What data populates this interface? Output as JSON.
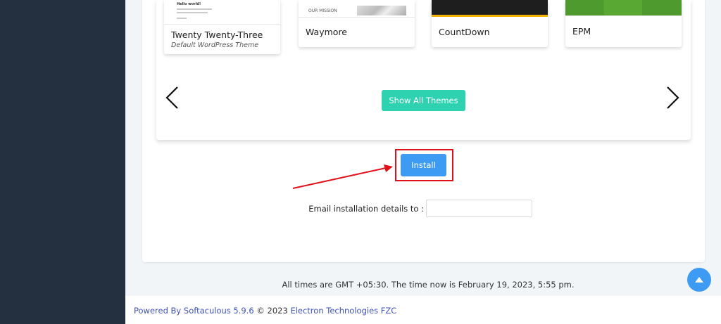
{
  "themes": [
    {
      "name": "Twenty Twenty-Three",
      "subtitle": "Default WordPress Theme",
      "thumb_text": "Hello world!"
    },
    {
      "name": "Waymore",
      "subtitle": "",
      "thumb_text": "OUR MISSION"
    },
    {
      "name": "CountDown",
      "subtitle": ""
    },
    {
      "name": "EPM",
      "subtitle": ""
    }
  ],
  "carousel": {
    "show_all_label": "Show All Themes",
    "prev_icon": "chevron-left-icon",
    "next_icon": "chevron-right-icon"
  },
  "install": {
    "button_label": "Install",
    "highlight_color": "#e0111a",
    "email_label": "Email installation details to :",
    "email_value": "",
    "email_placeholder": ""
  },
  "times_text": "All times are GMT +05:30. The time now is February 19, 2023, 5:55 pm.",
  "footer": {
    "powered_prefix": "Powered By",
    "softaculous_link": "Softaculous 5.9.6",
    "copyright": "© 2023",
    "company_link": "Electron Technologies FZC"
  },
  "colors": {
    "sidebar": "#24303f",
    "show_all_button": "#2ed2b0",
    "install_button": "#3e9bf3",
    "annotation_red": "#e0111a",
    "link": "#3f51b5"
  },
  "scroll_top_icon": "arrow-up-icon"
}
